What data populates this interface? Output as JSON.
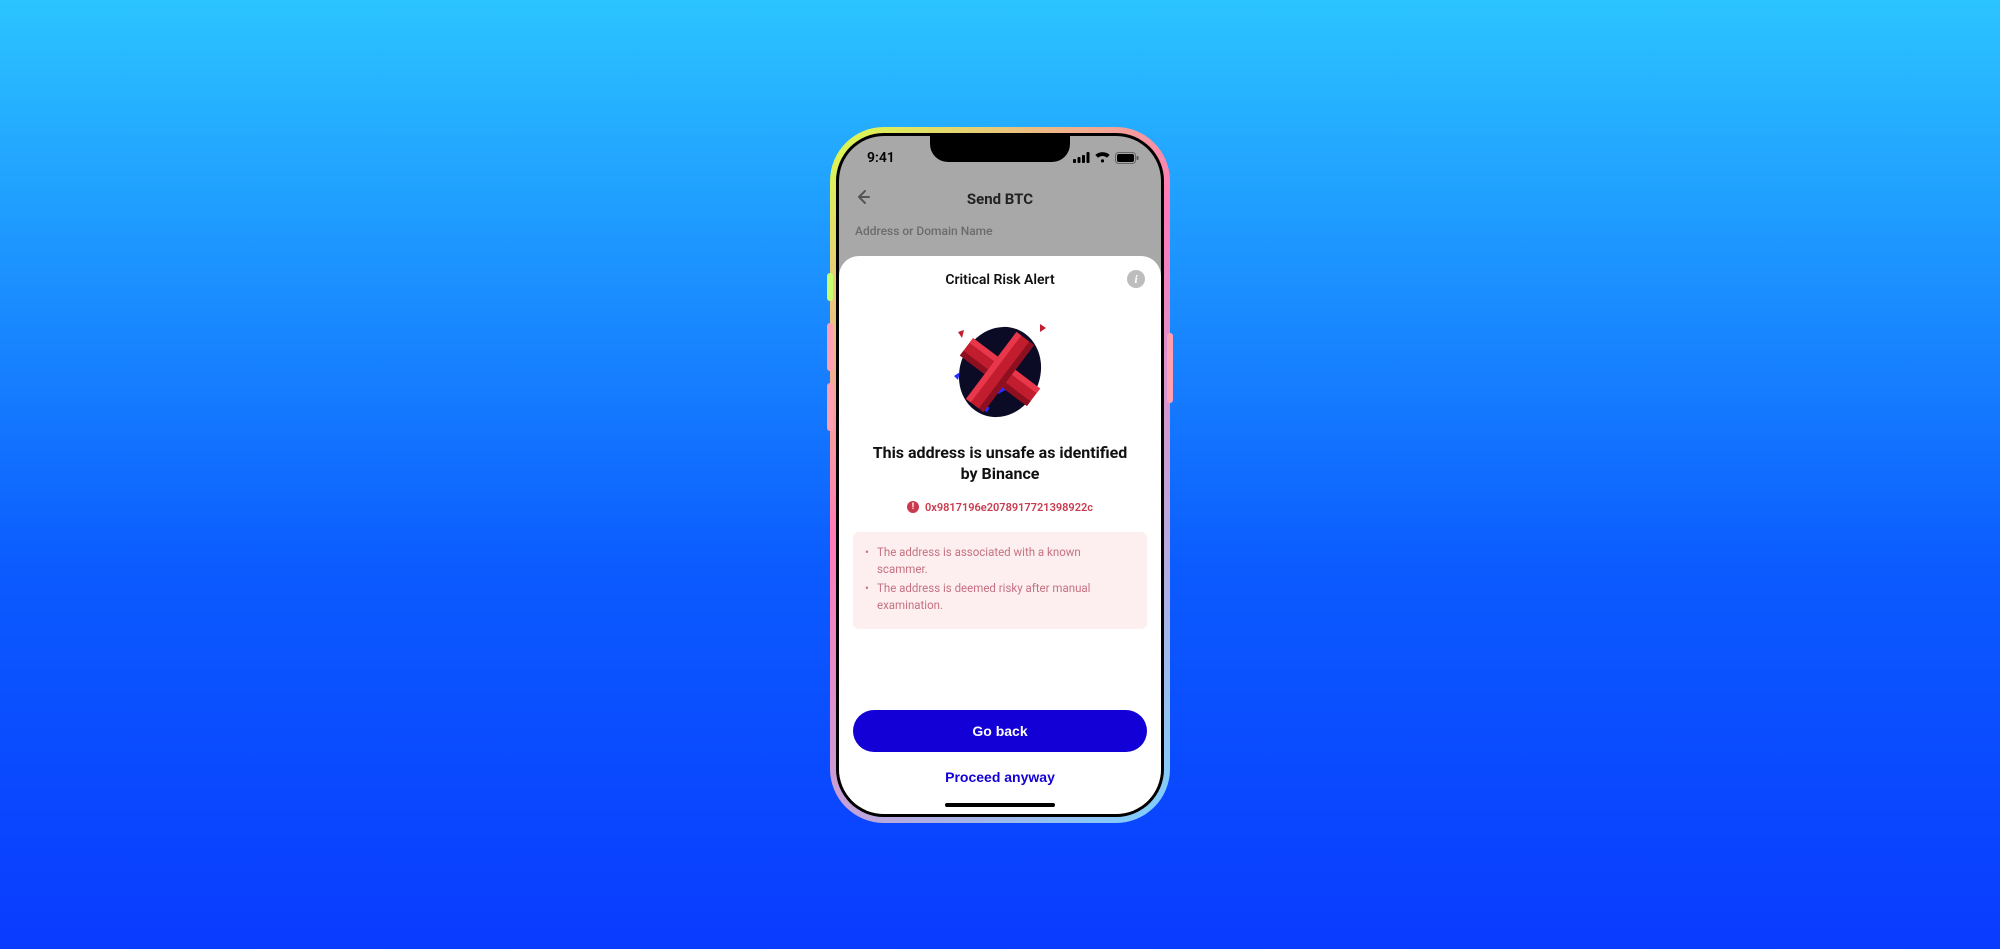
{
  "status": {
    "time": "9:41"
  },
  "header": {
    "title": "Send BTC",
    "input_label": "Address or Domain Name"
  },
  "sheet": {
    "title": "Critical Risk Alert",
    "heading": "This address is unsafe as identified by Binance",
    "address": "0x9817196e2078917721398922c",
    "reasons": [
      "The address is associated with a known scammer.",
      "The address is deemed risky after manual examination."
    ],
    "primary_label": "Go back",
    "secondary_label": "Proceed anyway"
  }
}
